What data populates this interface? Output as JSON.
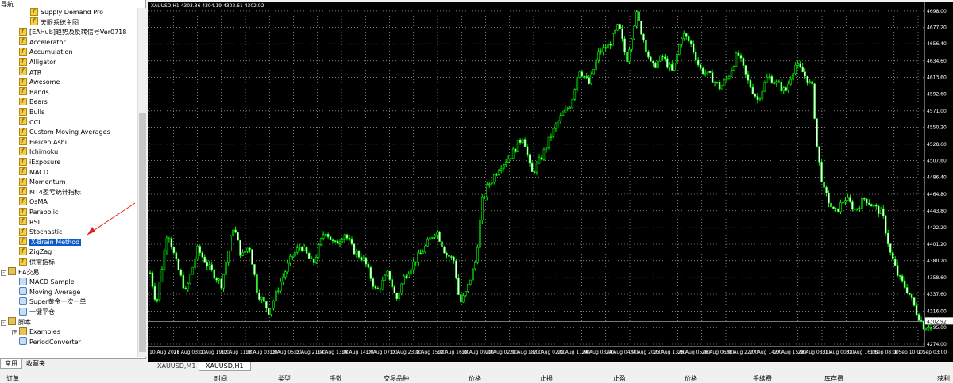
{
  "navigator": {
    "title": "导航",
    "items": [
      {
        "label": "Supply Demand Pro",
        "type": "ind",
        "indent": 2,
        "selected": false
      },
      {
        "label": "天眼系统主图",
        "type": "ind",
        "indent": 2,
        "selected": false
      },
      {
        "label": "[EAHub]趋势及反转信号Ver0718",
        "type": "ind",
        "indent": 1,
        "selected": false
      },
      {
        "label": "Accelerator",
        "type": "ind",
        "indent": 1,
        "selected": false
      },
      {
        "label": "Accumulation",
        "type": "ind",
        "indent": 1,
        "selected": false
      },
      {
        "label": "Alligator",
        "type": "ind",
        "indent": 1,
        "selected": false
      },
      {
        "label": "ATR",
        "type": "ind",
        "indent": 1,
        "selected": false
      },
      {
        "label": "Awesome",
        "type": "ind",
        "indent": 1,
        "selected": false
      },
      {
        "label": "Bands",
        "type": "ind",
        "indent": 1,
        "selected": false
      },
      {
        "label": "Bears",
        "type": "ind",
        "indent": 1,
        "selected": false
      },
      {
        "label": "Bulls",
        "type": "ind",
        "indent": 1,
        "selected": false
      },
      {
        "label": "CCI",
        "type": "ind",
        "indent": 1,
        "selected": false
      },
      {
        "label": "Custom Moving Averages",
        "type": "ind",
        "indent": 1,
        "selected": false
      },
      {
        "label": "Heiken Ashi",
        "type": "ind",
        "indent": 1,
        "selected": false
      },
      {
        "label": "Ichimoku",
        "type": "ind",
        "indent": 1,
        "selected": false
      },
      {
        "label": "iExposure",
        "type": "ind",
        "indent": 1,
        "selected": false
      },
      {
        "label": "MACD",
        "type": "ind",
        "indent": 1,
        "selected": false
      },
      {
        "label": "Momentum",
        "type": "ind",
        "indent": 1,
        "selected": false
      },
      {
        "label": "MT4盈亏统计指标",
        "type": "ind",
        "indent": 1,
        "selected": false
      },
      {
        "label": "OsMA",
        "type": "ind",
        "indent": 1,
        "selected": false
      },
      {
        "label": "Parabolic",
        "type": "ind",
        "indent": 1,
        "selected": false
      },
      {
        "label": "RSI",
        "type": "ind",
        "indent": 1,
        "selected": false
      },
      {
        "label": "Stochastic",
        "type": "ind",
        "indent": 1,
        "selected": false
      },
      {
        "label": "X-Brain Method",
        "type": "ind",
        "indent": 1,
        "selected": true
      },
      {
        "label": "ZigZag",
        "type": "ind",
        "indent": 1,
        "selected": false
      },
      {
        "label": "供需指标",
        "type": "ind",
        "indent": 1,
        "selected": false
      },
      {
        "label": "EA交易",
        "type": "folder",
        "indent": 0,
        "selected": false,
        "expander": "-"
      },
      {
        "label": "MACD Sample",
        "type": "ea",
        "indent": 1,
        "selected": false
      },
      {
        "label": "Moving Average",
        "type": "ea",
        "indent": 1,
        "selected": false
      },
      {
        "label": "Super黄金一次一单",
        "type": "ea",
        "indent": 1,
        "selected": false
      },
      {
        "label": "一键平仓",
        "type": "ea",
        "indent": 1,
        "selected": false
      },
      {
        "label": "脚本",
        "type": "folder",
        "indent": 0,
        "selected": false,
        "expander": "-"
      },
      {
        "label": "Examples",
        "type": "folder",
        "indent": 1,
        "selected": false,
        "expander": "+"
      },
      {
        "label": "PeriodConverter",
        "type": "ea",
        "indent": 1,
        "selected": false
      }
    ],
    "tabs": [
      "常用",
      "收藏夹"
    ]
  },
  "chart": {
    "title": "XAUUSD,H1  4303.36 4304.19 4302.61 4302.92",
    "current_price": "4302.92",
    "up_color": "#00ff00",
    "background": "#000000"
  },
  "chart_data": {
    "type": "candlestick",
    "symbol": "XAUUSD",
    "timeframe": "H1",
    "ylim": [
      4274.0,
      4700.0
    ],
    "y_ticks": [
      "4698.00",
      "4677.20",
      "4656.40",
      "4634.60",
      "4613.60",
      "4592.60",
      "4571.00",
      "4550.20",
      "4528.60",
      "4507.60",
      "4486.40",
      "4464.80",
      "4443.80",
      "4422.20",
      "4401.20",
      "4380.20",
      "4358.60",
      "4337.60",
      "4316.00",
      "4295.00",
      "4274.00"
    ],
    "x_ticks": [
      "10 Aug 2026",
      "11 Aug 03:00",
      "11 Aug 19:00",
      "12 Aug 11:00",
      "13 Aug 03:00",
      "13 Aug 05:00",
      "13 Aug 21:00",
      "14 Aug 13:00",
      "14 Aug 14:00",
      "17 Aug 07:00",
      "17 Aug 23:00",
      "18 Aug 15:00",
      "18 Aug 16:00",
      "19 Aug 09:00",
      "20 Aug 02:00",
      "20 Aug 18:00",
      "21 Aug 02:00",
      "21 Aug 11:00",
      "24 Aug 03:00",
      "24 Aug 04:00",
      "24 Aug 20:00",
      "25 Aug 13:00",
      "26 Aug 05:00",
      "26 Aug 06:00",
      "26 Aug 22:00",
      "27 Aug 14:00",
      "27 Aug 15:00",
      "28 Aug 08:00",
      "31 Aug 00:00",
      "31 Aug 16:00",
      "1 Sep 08:00",
      "1 Sep 10:00",
      "2 Sep 03:00"
    ],
    "path_points": [
      [
        0,
        4365
      ],
      [
        8,
        4325
      ],
      [
        22,
        4420
      ],
      [
        32,
        4380
      ],
      [
        45,
        4340
      ],
      [
        60,
        4395
      ],
      [
        75,
        4370
      ],
      [
        90,
        4350
      ],
      [
        105,
        4425
      ],
      [
        115,
        4385
      ],
      [
        125,
        4400
      ],
      [
        135,
        4340
      ],
      [
        150,
        4315
      ],
      [
        163,
        4350
      ],
      [
        178,
        4385
      ],
      [
        190,
        4400
      ],
      [
        205,
        4375
      ],
      [
        220,
        4420
      ],
      [
        232,
        4400
      ],
      [
        245,
        4415
      ],
      [
        255,
        4395
      ],
      [
        270,
        4380
      ],
      [
        285,
        4340
      ],
      [
        300,
        4365
      ],
      [
        310,
        4330
      ],
      [
        320,
        4360
      ],
      [
        330,
        4375
      ],
      [
        345,
        4395
      ],
      [
        360,
        4420
      ],
      [
        372,
        4390
      ],
      [
        383,
        4380
      ],
      [
        390,
        4325
      ],
      [
        398,
        4340
      ],
      [
        410,
        4380
      ],
      [
        418,
        4455
      ],
      [
        425,
        4475
      ],
      [
        440,
        4500
      ],
      [
        455,
        4515
      ],
      [
        470,
        4540
      ],
      [
        480,
        4490
      ],
      [
        492,
        4510
      ],
      [
        505,
        4540
      ],
      [
        515,
        4560
      ],
      [
        530,
        4580
      ],
      [
        540,
        4625
      ],
      [
        553,
        4605
      ],
      [
        565,
        4645
      ],
      [
        578,
        4655
      ],
      [
        590,
        4680
      ],
      [
        600,
        4635
      ],
      [
        612,
        4695
      ],
      [
        622,
        4660
      ],
      [
        632,
        4625
      ],
      [
        645,
        4640
      ],
      [
        658,
        4620
      ],
      [
        670,
        4670
      ],
      [
        682,
        4655
      ],
      [
        692,
        4625
      ],
      [
        705,
        4615
      ],
      [
        718,
        4600
      ],
      [
        728,
        4615
      ],
      [
        740,
        4645
      ],
      [
        752,
        4610
      ],
      [
        765,
        4585
      ],
      [
        778,
        4615
      ],
      [
        790,
        4605
      ],
      [
        800,
        4595
      ],
      [
        812,
        4630
      ],
      [
        822,
        4620
      ],
      [
        834,
        4600
      ],
      [
        840,
        4520
      ],
      [
        848,
        4470
      ],
      [
        862,
        4440
      ],
      [
        875,
        4460
      ],
      [
        888,
        4445
      ],
      [
        900,
        4460
      ],
      [
        910,
        4450
      ],
      [
        922,
        4440
      ],
      [
        932,
        4390
      ],
      [
        942,
        4360
      ],
      [
        955,
        4340
      ],
      [
        965,
        4315
      ],
      [
        975,
        4295
      ],
      [
        983,
        4300
      ]
    ]
  },
  "symbol_tabs": [
    {
      "label": "XAUUSD,M1",
      "active": false
    },
    {
      "label": "XAUUSD,H1",
      "active": true
    }
  ],
  "terminal": {
    "columns": [
      "订单",
      "时间",
      "类型",
      "手数",
      "交易品种",
      "价格",
      "止损",
      "止盈",
      "价格",
      "手续费",
      "库存费",
      "获利"
    ]
  }
}
